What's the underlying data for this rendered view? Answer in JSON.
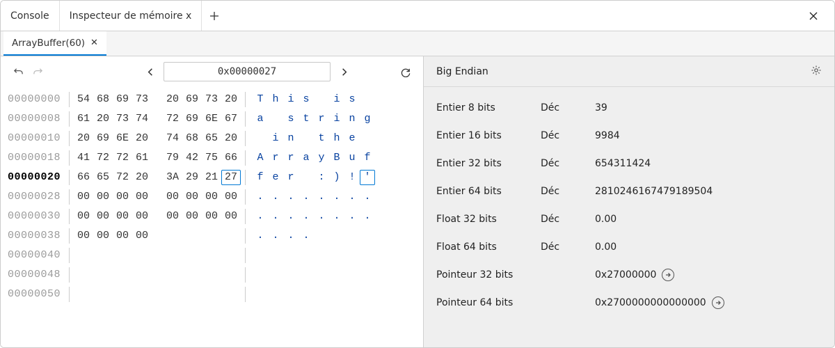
{
  "tabs": {
    "console_label": "Console",
    "inspector_label": "Inspecteur de mémoire x"
  },
  "inner_tab": {
    "label": "ArrayBuffer(60)"
  },
  "toolbar": {
    "address": "0x00000027"
  },
  "endian_label": "Big Endian",
  "hex": {
    "rows": [
      {
        "addr": "00000000",
        "bytes": [
          "54",
          "68",
          "69",
          "73",
          "20",
          "69",
          "73",
          "20"
        ],
        "ascii": [
          "T",
          "h",
          "i",
          "s",
          " ",
          "i",
          "s",
          " "
        ]
      },
      {
        "addr": "00000008",
        "bytes": [
          "61",
          "20",
          "73",
          "74",
          "72",
          "69",
          "6E",
          "67"
        ],
        "ascii": [
          "a",
          " ",
          "s",
          "t",
          "r",
          "i",
          "n",
          "g"
        ]
      },
      {
        "addr": "00000010",
        "bytes": [
          "20",
          "69",
          "6E",
          "20",
          "74",
          "68",
          "65",
          "20"
        ],
        "ascii": [
          " ",
          "i",
          "n",
          " ",
          "t",
          "h",
          "e",
          " "
        ]
      },
      {
        "addr": "00000018",
        "bytes": [
          "41",
          "72",
          "72",
          "61",
          "79",
          "42",
          "75",
          "66"
        ],
        "ascii": [
          "A",
          "r",
          "r",
          "a",
          "y",
          "B",
          "u",
          "f"
        ]
      },
      {
        "addr": "00000020",
        "bytes": [
          "66",
          "65",
          "72",
          "20",
          "3A",
          "29",
          "21",
          "27"
        ],
        "ascii": [
          "f",
          "e",
          "r",
          " ",
          ":",
          ")",
          "!",
          "'"
        ],
        "current": true,
        "selected_index": 7
      },
      {
        "addr": "00000028",
        "bytes": [
          "00",
          "00",
          "00",
          "00",
          "00",
          "00",
          "00",
          "00"
        ],
        "ascii": [
          ".",
          ".",
          ".",
          ".",
          ".",
          ".",
          ".",
          "."
        ]
      },
      {
        "addr": "00000030",
        "bytes": [
          "00",
          "00",
          "00",
          "00",
          "00",
          "00",
          "00",
          "00"
        ],
        "ascii": [
          ".",
          ".",
          ".",
          ".",
          ".",
          ".",
          ".",
          "."
        ]
      },
      {
        "addr": "00000038",
        "bytes": [
          "00",
          "00",
          "00",
          "00"
        ],
        "ascii": [
          ".",
          ".",
          ".",
          "."
        ]
      },
      {
        "addr": "00000040",
        "bytes": [],
        "ascii": []
      },
      {
        "addr": "00000048",
        "bytes": [],
        "ascii": []
      },
      {
        "addr": "00000050",
        "bytes": [],
        "ascii": []
      }
    ]
  },
  "values": [
    {
      "label": "Entier 8 bits",
      "repr": "Déc",
      "value": "39"
    },
    {
      "label": "Entier 16 bits",
      "repr": "Déc",
      "value": "9984"
    },
    {
      "label": "Entier 32 bits",
      "repr": "Déc",
      "value": "654311424"
    },
    {
      "label": "Entier 64 bits",
      "repr": "Déc",
      "value": "2810246167479189504"
    },
    {
      "label": "Float 32 bits",
      "repr": "Déc",
      "value": "0.00"
    },
    {
      "label": "Float 64 bits",
      "repr": "Déc",
      "value": "0.00"
    },
    {
      "label": "Pointeur 32 bits",
      "repr": "",
      "value": "0x27000000",
      "jump": true
    },
    {
      "label": "Pointeur 64 bits",
      "repr": "",
      "value": "0x2700000000000000",
      "jump": true
    }
  ]
}
